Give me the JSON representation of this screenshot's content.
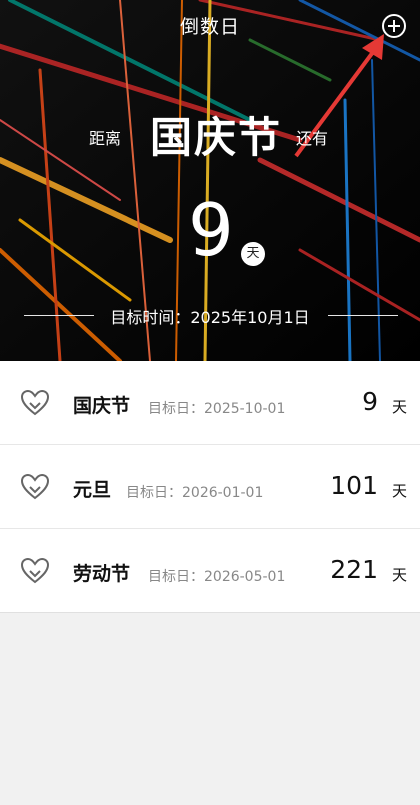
{
  "header": {
    "title": "倒数日",
    "add_icon": "plus-circle-icon"
  },
  "hero": {
    "prefix": "距离",
    "event": "国庆节",
    "suffix": "还有",
    "days": "9",
    "day_unit": "天",
    "target_label": "目标时间：2025年10月1日"
  },
  "list": [
    {
      "name": "国庆节",
      "meta": "目标日：2025-10-01",
      "count": "9",
      "unit": "天"
    },
    {
      "name": "元旦",
      "meta": "目标日：2026-01-01",
      "count": "101",
      "unit": "天"
    },
    {
      "name": "劳动节",
      "meta": "目标日：2026-05-01",
      "count": "221",
      "unit": "天"
    }
  ],
  "colors": {
    "hero_bg": "#05070d",
    "annotation_arrow": "#e53935"
  }
}
